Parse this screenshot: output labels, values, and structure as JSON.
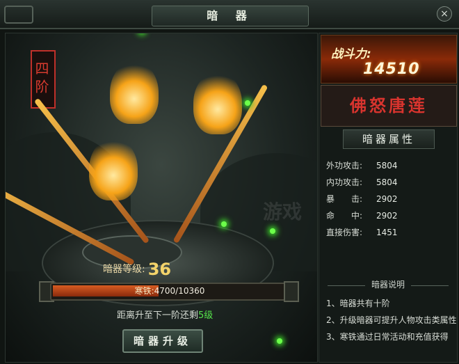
{
  "window": {
    "title": "暗 器",
    "close_label": "×"
  },
  "weapon": {
    "stage_label": "四阶",
    "level_label": "暗器等级:",
    "level_value": "36",
    "material_label": "寒铁:",
    "material_current": "4700",
    "material_total": "10360",
    "material_text": "4700/10360",
    "material_progress": 0.4537,
    "remain_prefix": "距离升至下一阶还剩",
    "remain_value": "5级",
    "upgrade_label": "暗器升级",
    "watermark": "游戏"
  },
  "panel": {
    "power_label": "战斗力:",
    "power_value": "14510",
    "weapon_name": "佛怒唐莲",
    "attr_header": "暗器属性",
    "stats": [
      {
        "label": "外功攻击:",
        "value": "5804"
      },
      {
        "label": "内功攻击:",
        "value": "5804"
      },
      {
        "label": "暴　　击:",
        "value": "2902"
      },
      {
        "label": "命　　中:",
        "value": "2902"
      },
      {
        "label": "直接伤害:",
        "value": "1451"
      }
    ],
    "desc_header": "暗器说明",
    "desc": [
      "1、暗器共有十阶",
      "2、升级暗器可提升人物攻击类属性",
      "3、寒铁通过日常活动和充值获得"
    ]
  },
  "colors": {
    "accent_red": "#d8342e",
    "level_gold": "#f3d36a",
    "remain_green": "#55e34a",
    "bar_fill": "#d85c22"
  }
}
